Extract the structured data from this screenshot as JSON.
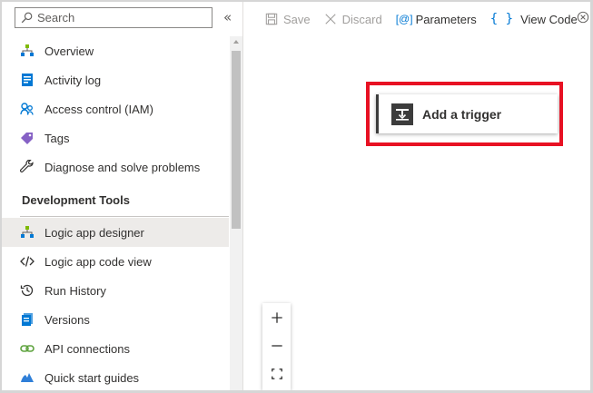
{
  "search": {
    "placeholder": "Search"
  },
  "collapse_glyph": "«",
  "menu": {
    "items_top": [
      {
        "label": "Overview",
        "icon": "overview-icon"
      },
      {
        "label": "Activity log",
        "icon": "activity-log-icon"
      },
      {
        "label": "Access control (IAM)",
        "icon": "access-control-icon"
      },
      {
        "label": "Tags",
        "icon": "tag-icon"
      },
      {
        "label": "Diagnose and solve problems",
        "icon": "wrench-icon"
      }
    ],
    "section_title": "Development Tools",
    "items_dev": [
      {
        "label": "Logic app designer",
        "icon": "designer-icon",
        "selected": true
      },
      {
        "label": "Logic app code view",
        "icon": "code-icon"
      },
      {
        "label": "Run History",
        "icon": "history-icon"
      },
      {
        "label": "Versions",
        "icon": "versions-icon"
      },
      {
        "label": "API connections",
        "icon": "api-connections-icon"
      },
      {
        "label": "Quick start guides",
        "icon": "quickstart-icon"
      }
    ]
  },
  "toolbar": {
    "save_label": "Save",
    "discard_label": "Discard",
    "parameters_label": "Parameters",
    "parameters_glyph": "[@]",
    "view_code_label": "View Code",
    "view_code_glyph": "{ }"
  },
  "trigger": {
    "label": "Add a trigger"
  },
  "colors": {
    "highlight": "#e81123",
    "accent": "#0078d4",
    "selected_bg": "#edebe9"
  }
}
